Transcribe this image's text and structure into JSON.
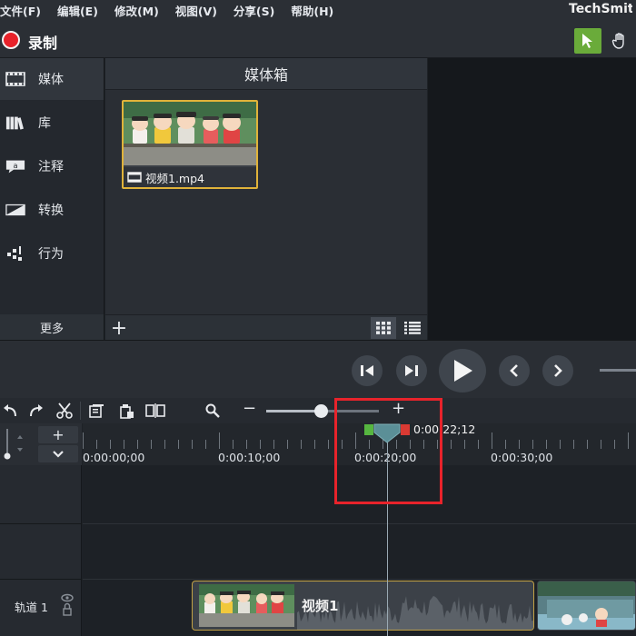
{
  "menu": {
    "items": [
      "文件(F)",
      "编辑(E)",
      "修改(M)",
      "视图(V)",
      "分享(S)",
      "帮助(H)"
    ],
    "brand": "TechSmith"
  },
  "toolbar": {
    "record_label": "录制",
    "record_color": "#e8222a",
    "select_tool_color": "#6aab3a"
  },
  "sidebar": {
    "items": [
      {
        "label": "媒体",
        "icon": "film-strip-icon",
        "active": true
      },
      {
        "label": "库",
        "icon": "library-books-icon",
        "active": false
      },
      {
        "label": "注释",
        "icon": "callout-icon",
        "active": false
      },
      {
        "label": "转换",
        "icon": "transition-icon",
        "active": false
      },
      {
        "label": "行为",
        "icon": "behavior-icon",
        "active": false
      }
    ],
    "more_label": "更多"
  },
  "media_bin": {
    "title": "媒体箱",
    "items": [
      {
        "name": "视频1.mp4",
        "icon": "video-file-icon"
      }
    ],
    "add_label": "+"
  },
  "timeline": {
    "ruler_labels": [
      "0:00:00;00",
      "0:00:10;00",
      "0:00:20;00",
      "0:00:30;00"
    ],
    "playhead_time": "0:00:22;12",
    "track_label": "轨道 1",
    "clip_name": "视频1",
    "zoom_minus": "−",
    "zoom_plus": "+",
    "zoom_level": 0.5,
    "add_track_label": "+"
  },
  "colors": {
    "highlight": "#e8232b",
    "clip_border": "#c2a145",
    "playhead_in": "#56b640",
    "playhead_out": "#d93a33"
  }
}
